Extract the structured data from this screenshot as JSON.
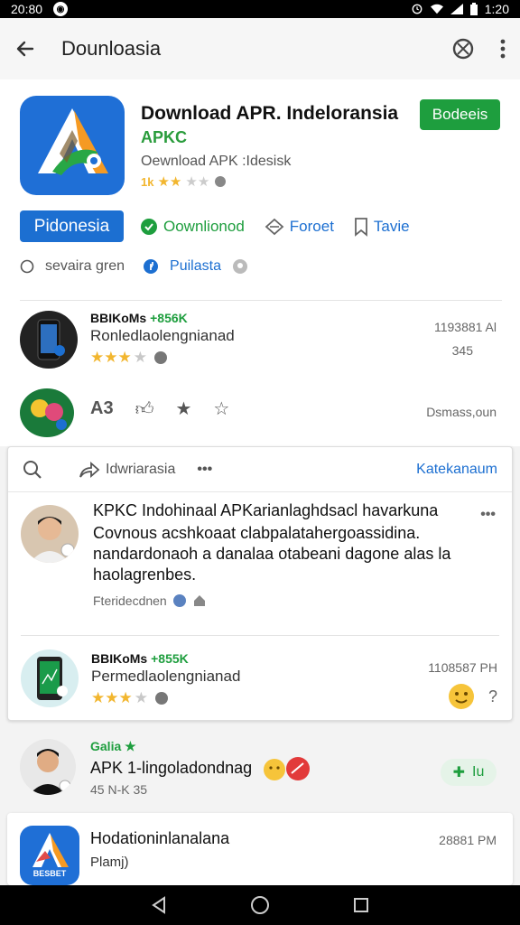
{
  "status": {
    "time_left": "20:80",
    "time_right": "1:20"
  },
  "appbar": {
    "title": "Dounloasia"
  },
  "hero": {
    "title": "Download APR. Indeloransia",
    "subtitle": "APKC",
    "developer": "Oewnload APK :Idesisk",
    "rating_text": "1k",
    "badge_label": "Bodeeis",
    "pill_label": "Pidonesia",
    "actions": {
      "download": "Oownlionod",
      "forward": "Foroet",
      "save": "Tavie"
    },
    "meta": {
      "left": "sevaira gren",
      "right": "Puilasta"
    }
  },
  "row1": {
    "title": "BBIKoMs",
    "title_green": "+856K",
    "subtitle": "Ronledlaolengnianad",
    "right_top": "1193881 Al",
    "right_bottom": "345"
  },
  "row2": {
    "count": "A3",
    "right": "Dsmass,oun"
  },
  "card": {
    "toolbar_label": "Idwriarasia",
    "toolbar_more": "•••",
    "toolbar_link": "Katekanaum",
    "post": {
      "title": "KPKC Indohinaal APKarianlaghdsacl havarkuna",
      "body": "Covnous acshkoaat clabpalatahergoassidina. nandardonaoh a danalaa otabeani dagone alas la haolagrenbes.",
      "meta": "Fteridecdnen"
    },
    "row": {
      "title": "BBIKoMs",
      "title_green": "+855K",
      "subtitle": "Permedlaolengnianad",
      "right_top": "1108587 PH",
      "right_bottom": "?"
    }
  },
  "row3": {
    "title": "Galia ★",
    "subtitle": "APK 1-lingoladondnag",
    "meta": "45 N-K 35",
    "pill_label": "Iu"
  },
  "row4": {
    "title": "Hodationinlanalana",
    "subtitle": "Plamj)",
    "right": "28881 PM",
    "icon_text": "BESBET"
  }
}
